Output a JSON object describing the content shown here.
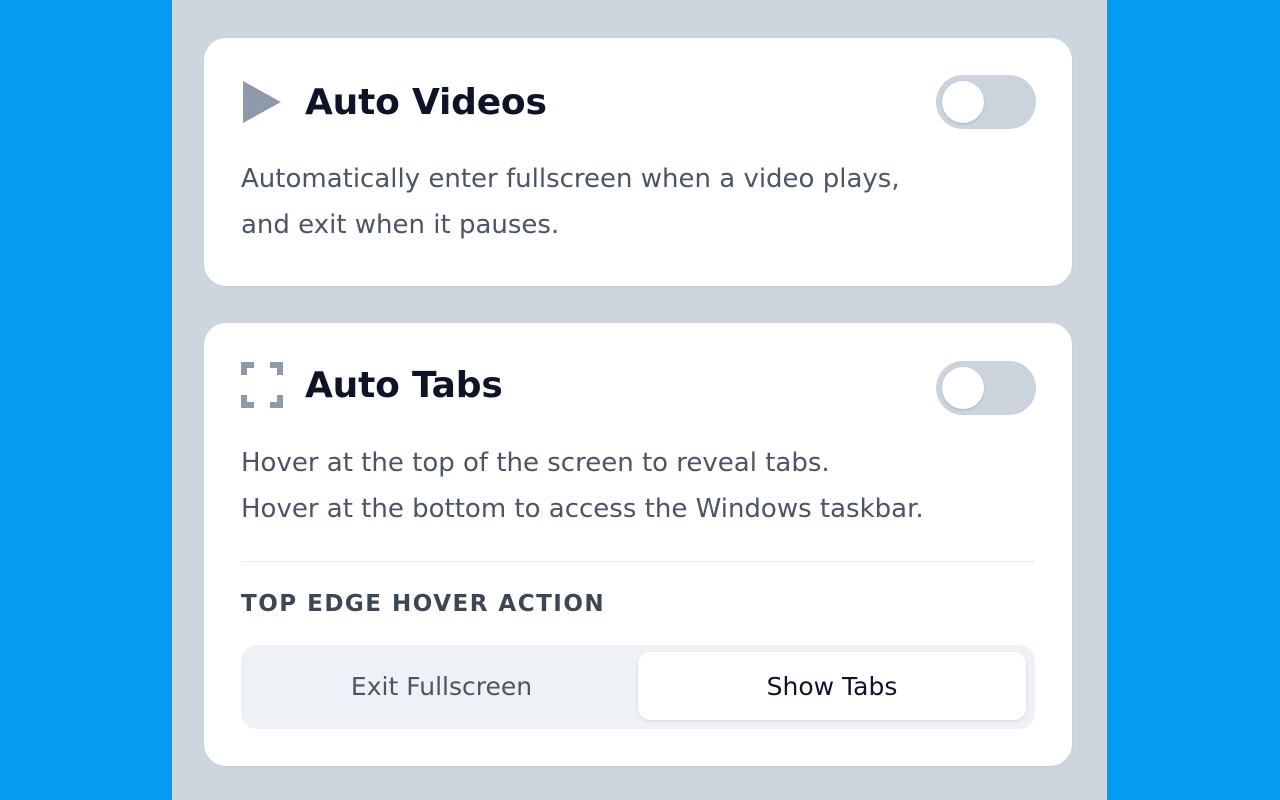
{
  "colors": {
    "background": "#049cf0",
    "panel": "#cdd5df",
    "card": "#ffffff",
    "title": "#0e1428",
    "text": "#4b5565",
    "icon": "#8e99ab",
    "toggle_off": "#cbd3dd"
  },
  "auto_videos": {
    "icon": "play-icon",
    "title": "Auto Videos",
    "enabled": false,
    "description": [
      "Automatically enter fullscreen when a video plays,",
      "and exit when it pauses."
    ]
  },
  "auto_tabs": {
    "icon": "fullscreen-corners-icon",
    "title": "Auto Tabs",
    "enabled": false,
    "description": [
      "Hover at the top of the screen to reveal tabs.",
      "Hover at the bottom to access the Windows taskbar."
    ],
    "top_edge": {
      "label": "TOP EDGE HOVER ACTION",
      "options": [
        "Exit Fullscreen",
        "Show Tabs"
      ],
      "selected": "Show Tabs"
    }
  }
}
